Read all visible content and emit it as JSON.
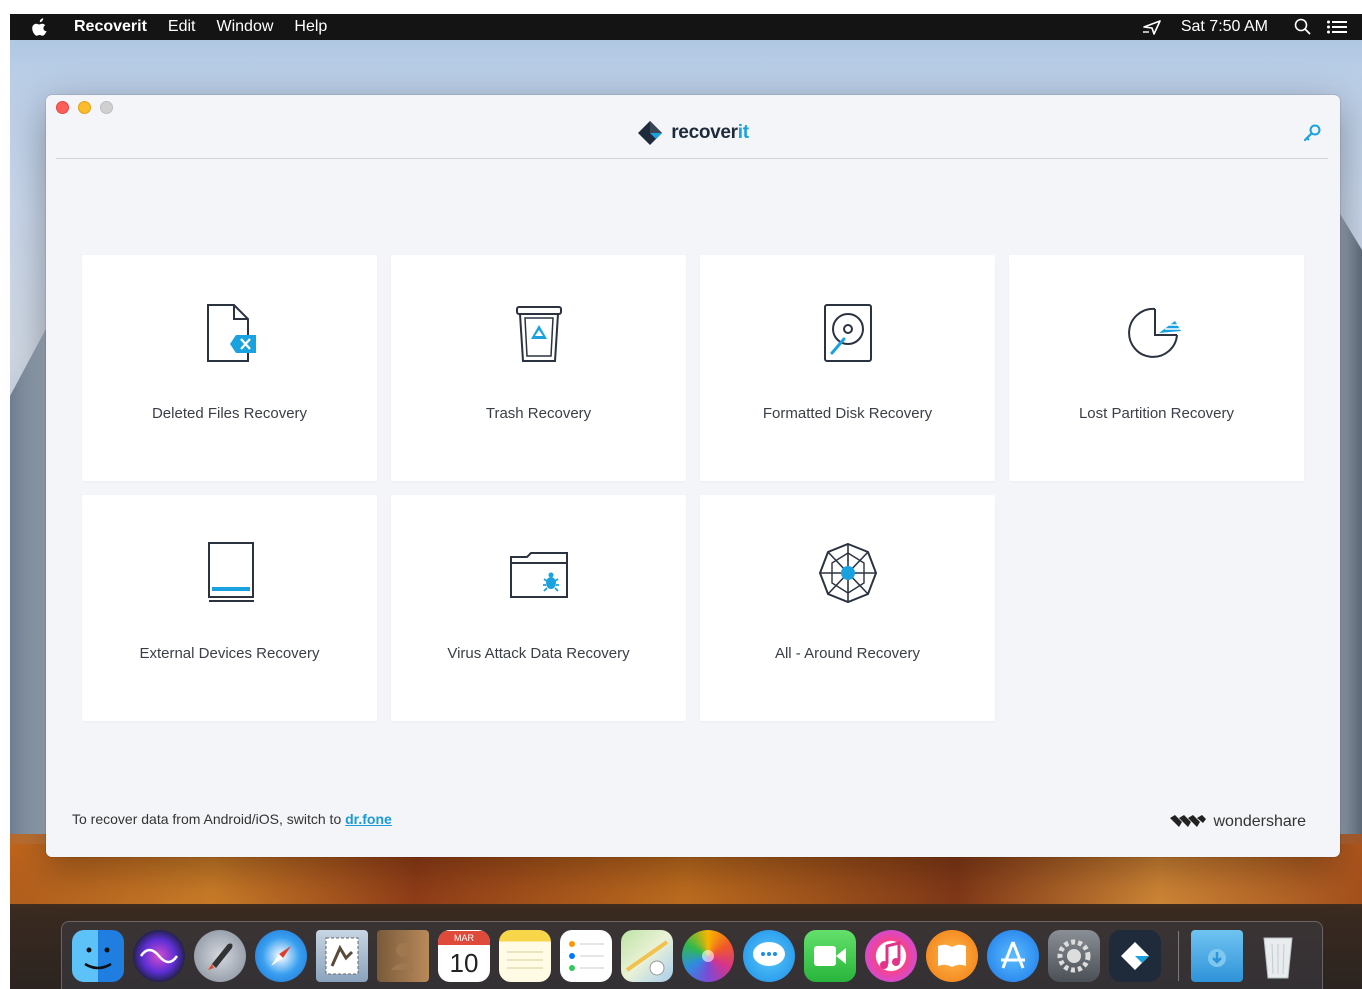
{
  "menubar": {
    "app_name": "Recoverit",
    "items": [
      "Edit",
      "Window",
      "Help"
    ],
    "clock": "Sat 7:50 AM"
  },
  "window": {
    "brand_prefix": "recover",
    "brand_suffix": "it"
  },
  "cards": [
    {
      "label": "Deleted Files Recovery",
      "icon": "deleted-file-icon"
    },
    {
      "label": "Trash Recovery",
      "icon": "trash-icon"
    },
    {
      "label": "Formatted Disk Recovery",
      "icon": "disk-icon"
    },
    {
      "label": "Lost Partition Recovery",
      "icon": "partition-icon"
    },
    {
      "label": "External Devices Recovery",
      "icon": "external-device-icon"
    },
    {
      "label": "Virus Attack Data Recovery",
      "icon": "virus-icon"
    },
    {
      "label": "All - Around Recovery",
      "icon": "all-around-icon"
    }
  ],
  "footer": {
    "note_prefix": "To recover data from Android/iOS, switch to ",
    "link_text": "dr.fone",
    "brand": "wondershare"
  },
  "dock": {
    "calendar_month": "MAR",
    "calendar_day": "10",
    "apps": [
      "Finder",
      "Siri",
      "Launchpad",
      "Safari",
      "Mail",
      "Contacts",
      "Calendar",
      "Notes",
      "Reminders",
      "Maps",
      "Photos",
      "Messages",
      "FaceTime",
      "iTunes",
      "iBooks",
      "App Store",
      "System Preferences",
      "Recoverit",
      "Downloads",
      "Trash"
    ]
  },
  "colors": {
    "accent": "#1aa2e0",
    "icon_dark": "#2b3340",
    "window_bg": "#f4f5f8"
  }
}
